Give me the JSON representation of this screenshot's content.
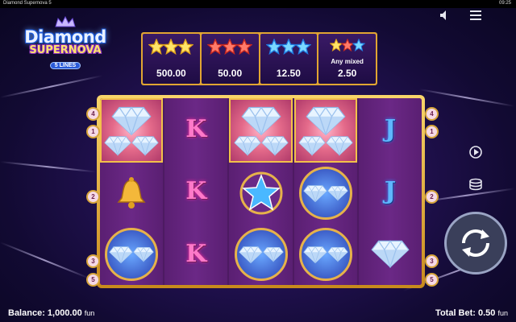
{
  "system_bar": {
    "title": "Diamond Supernova 5",
    "clock": "09:25"
  },
  "logo": {
    "line1": "Diamond",
    "line2": "SUPERNOVA",
    "badge": "5 LINES"
  },
  "paytable": [
    {
      "stars": [
        "gold",
        "gold",
        "gold"
      ],
      "value": "500.00"
    },
    {
      "stars": [
        "red",
        "red",
        "red"
      ],
      "value": "50.00"
    },
    {
      "stars": [
        "blue",
        "blue",
        "blue"
      ],
      "value": "12.50"
    },
    {
      "stars": [
        "gold",
        "red",
        "blue"
      ],
      "label": "Any mixed",
      "value": "2.50"
    }
  ],
  "reels": [
    [
      "diamond-highlight",
      "bell",
      "diamond-blue"
    ],
    [
      "K",
      "K",
      "K"
    ],
    [
      "diamond-highlight",
      "blue-star",
      "diamond-blue"
    ],
    [
      "diamond-highlight",
      "diamond-blue",
      "diamond-blue"
    ],
    [
      "J",
      "J",
      "diamond-plain"
    ]
  ],
  "paylines": {
    "left": [
      "4",
      "1",
      "2",
      "3",
      "5"
    ],
    "right": [
      "4",
      "1",
      "2",
      "3",
      "5"
    ]
  },
  "controls": {
    "sound_icon": "speaker-icon",
    "menu_icon": "hamburger-icon",
    "autoplay_icon": "autoplay-icon",
    "bet_icon": "coins-icon",
    "spin_icon": "spin-arrows-icon"
  },
  "footer": {
    "balance_label": "Balance: 1,000.00",
    "balance_unit": "fun",
    "bet_label": "Total Bet: 0.50",
    "bet_unit": "fun"
  }
}
